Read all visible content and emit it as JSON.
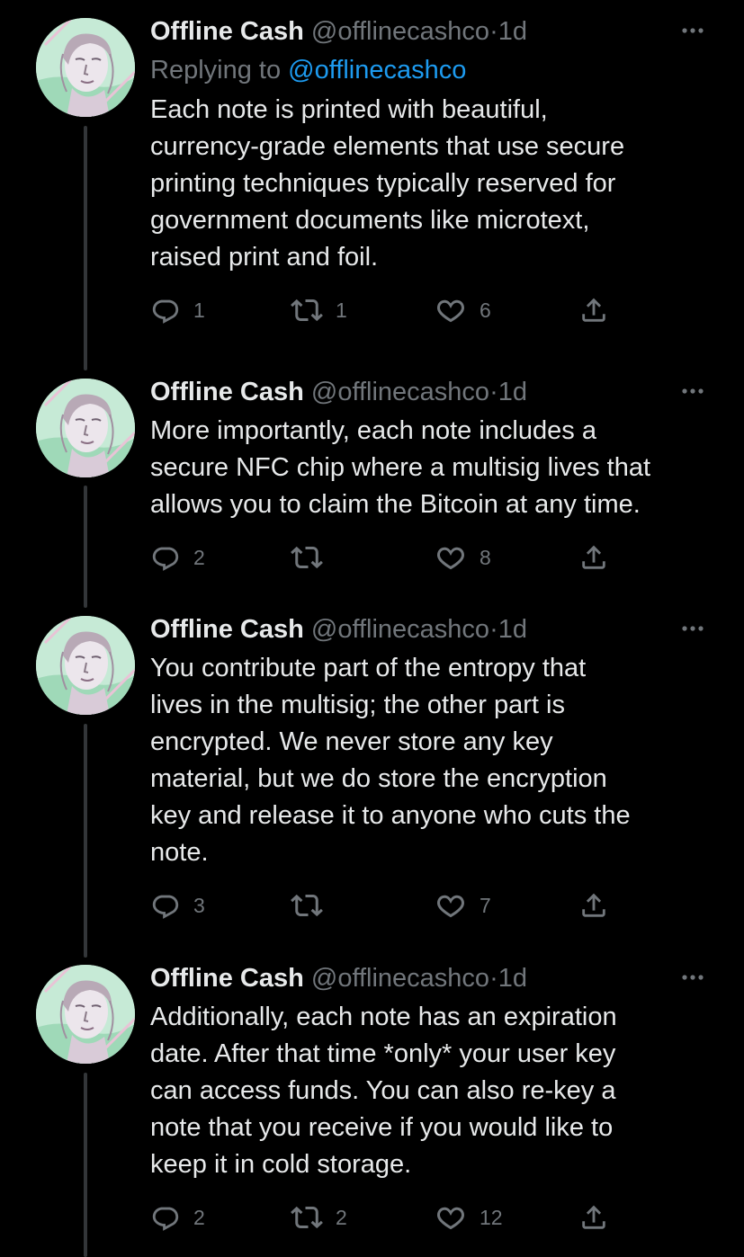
{
  "colors": {
    "background": "#000000",
    "text_primary": "#e7e9ea",
    "text_secondary": "#71767b",
    "link": "#1d9bf0",
    "thread_line": "#333639"
  },
  "icons": {
    "reply": "reply-icon",
    "retweet": "retweet-icon",
    "like": "heart-icon",
    "share": "share-icon",
    "more": "more-icon",
    "avatar": "avatar-statue-image"
  },
  "tweets": [
    {
      "name": "Offline Cash",
      "handle": "@offlinecashco",
      "dot": "·",
      "time": "1d",
      "replying_prefix": "Replying to",
      "replying_to": "@offlinecashco",
      "lines": [
        "Each note is printed with beautiful,",
        "currency-grade elements that use secure",
        "printing techniques typically reserved for",
        "government documents like microtext,",
        "raised print and foil."
      ],
      "replies": "1",
      "retweets": "1",
      "likes": "6"
    },
    {
      "name": "Offline Cash",
      "handle": "@offlinecashco",
      "dot": "·",
      "time": "1d",
      "lines": [
        "More importantly, each note includes a",
        "secure NFC chip where a multisig lives that",
        "allows you to claim the Bitcoin at any time."
      ],
      "replies": "2",
      "retweets": "",
      "likes": "8"
    },
    {
      "name": "Offline Cash",
      "handle": "@offlinecashco",
      "dot": "·",
      "time": "1d",
      "lines": [
        "You contribute part of the entropy that",
        "lives in the multisig; the other part is",
        "encrypted. We never store any key",
        "material, but we do store the encryption",
        "key and release it to anyone who cuts the",
        "note."
      ],
      "replies": "3",
      "retweets": "",
      "likes": "7"
    },
    {
      "name": "Offline Cash",
      "handle": "@offlinecashco",
      "dot": "·",
      "time": "1d",
      "lines": [
        "Additionally, each note has an expiration",
        "date. After that time *only* your user key",
        "can access funds. You can also re-key a",
        "note that you receive if you would like to",
        "keep it in cold storage."
      ],
      "replies": "2",
      "retweets": "2",
      "likes": "12"
    }
  ]
}
